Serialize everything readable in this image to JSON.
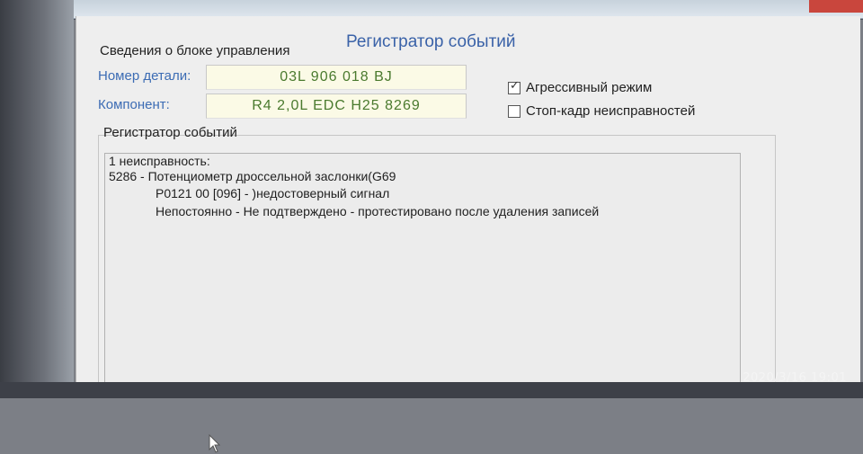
{
  "window": {
    "title": "Регистратор событий"
  },
  "control_unit": {
    "group_label": "Сведения о блоке управления",
    "part_number_label": "Номер детали:",
    "part_number_value": "03L 906 018 BJ",
    "component_label": "Компонент:",
    "component_value": "R4 2,0L EDC   H25 8269"
  },
  "options": {
    "aggressive_mode": {
      "label": "Агрессивный режим",
      "checked": true
    },
    "freeze_frame": {
      "label": "Стоп-кадр неисправностей",
      "checked": false
    }
  },
  "events": {
    "group_label": "Регистратор событий",
    "lines": [
      "1 неисправность:",
      "5286 - Потенциометр дроссельной заслонки(G69",
      "P0121 00 [096] - )недостоверный сигнал",
      "Непостоянно - Не подтверждено - протестировано после удаления записей"
    ]
  },
  "photo_timestamp": "2020/3/16  19:01",
  "colors": {
    "title": "#3a62a8",
    "row_label": "#3c6cb4",
    "field_text": "#4a7a2e",
    "field_bg": "#fbfae6"
  }
}
